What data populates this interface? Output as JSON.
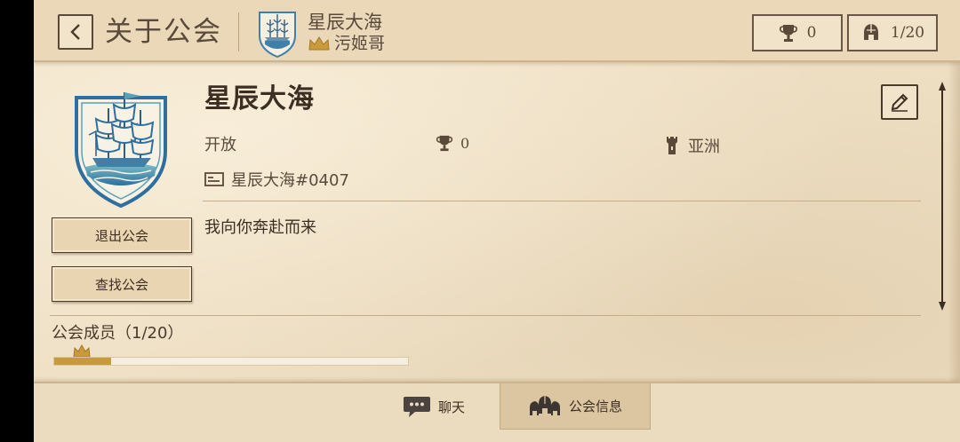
{
  "header": {
    "back_label": "<",
    "title": "关于公会",
    "guild_name": "星辰大海",
    "leader_name": "污姬哥",
    "trophy_count": "0",
    "member_count": "1/20"
  },
  "guild": {
    "name": "星辰大海",
    "status": "开放",
    "trophies": "0",
    "region": "亚洲",
    "tag": "星辰大海#0407",
    "description": "我向你奔赴而来"
  },
  "actions": {
    "leave_label": "退出公会",
    "find_label": "查找公会"
  },
  "members": {
    "title": "公会成员（1/20）",
    "progress": 0.16
  },
  "tabs": [
    {
      "label": "聊天",
      "icon": "chat-bubble-icon",
      "selected": false
    },
    {
      "label": "公会信息",
      "icon": "guild-helmets-icon",
      "selected": true
    }
  ],
  "colors": {
    "paper": "#efe0c5",
    "ink": "#3c2e22",
    "gold": "#c89a3c",
    "emblem_blue": "#3f7fa8"
  }
}
